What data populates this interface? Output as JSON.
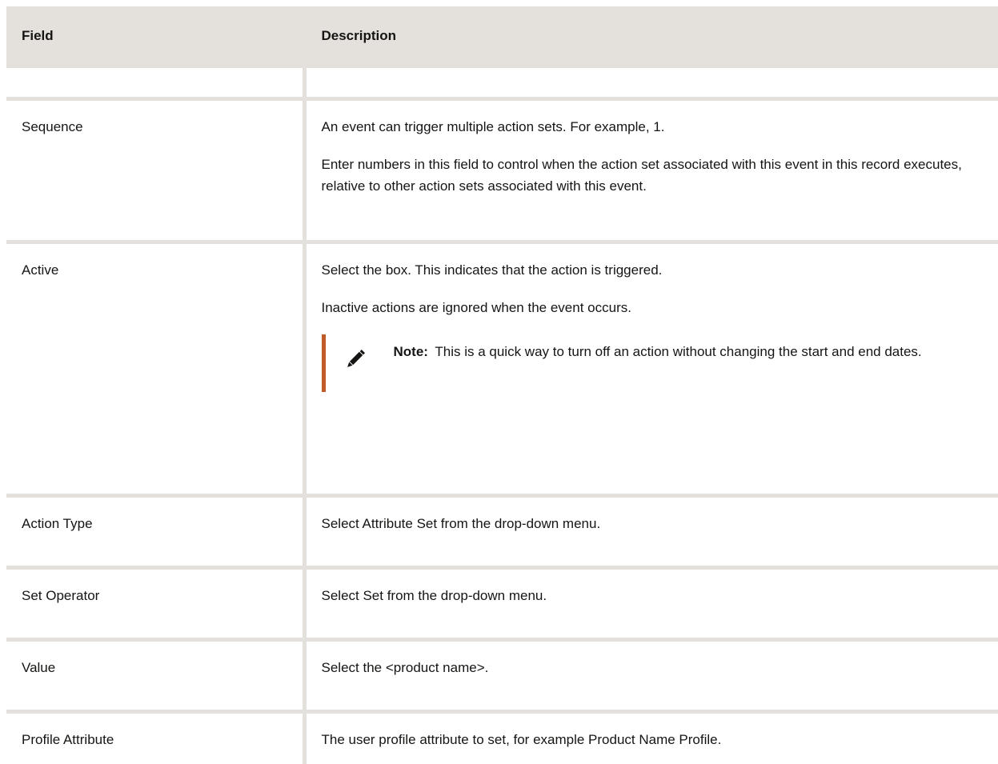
{
  "table": {
    "headers": {
      "field": "Field",
      "description": "Description"
    },
    "rows": [
      {
        "field": "",
        "description": [
          ""
        ]
      },
      {
        "field": "Sequence",
        "description": [
          "An event can trigger multiple action sets. For example, 1.",
          "Enter numbers in this field to control when the action set associated with this event in this record executes, relative to other action sets associated with this event."
        ]
      },
      {
        "field": "Active",
        "description": [
          "Select the box. This indicates that the action is triggered.",
          "Inactive actions are ignored when the event occurs."
        ],
        "note": {
          "icon": "pencil-icon",
          "label": "Note:",
          "text": "This is a quick way to turn off an action without changing the start and end dates."
        }
      },
      {
        "field": "Action Type",
        "description": [
          "Select Attribute Set from the drop-down menu."
        ]
      },
      {
        "field": "Set Operator",
        "description": [
          "Select Set from the drop-down menu."
        ]
      },
      {
        "field": "Value",
        "description": [
          "Select the <product name>."
        ]
      },
      {
        "field": "Profile Attribute",
        "description": [
          "The user profile attribute to set, for example Product Name Profile."
        ]
      }
    ]
  },
  "colors": {
    "header_bg": "#e4e1dc",
    "border": "#e4e1dc",
    "note_accent": "#c05a27",
    "text": "#161513"
  }
}
